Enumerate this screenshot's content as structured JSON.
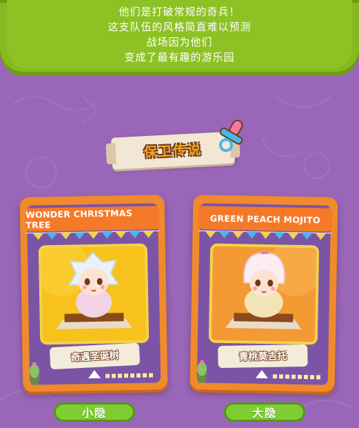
{
  "banner": {
    "lines": [
      "他们是打破常规的奇兵！",
      "这支队伍的风格简直难以预测",
      "战场因为他们",
      "变成了最有趣的游乐园"
    ]
  },
  "section": {
    "title": "保卫传说"
  },
  "cards": [
    {
      "title": "WONDER CHRISTMAS TREE",
      "name": "奇遇圣诞树",
      "tab_label": "小隐"
    },
    {
      "title": "GREEN PEACH MOJITO",
      "name": "青桃莫吉托",
      "tab_label": "大隐"
    }
  ],
  "colors": {
    "background": "#9a66b8",
    "banner": "#8cc224",
    "card_orange": "#f08a2c",
    "tab_green": "#7fcd30"
  }
}
